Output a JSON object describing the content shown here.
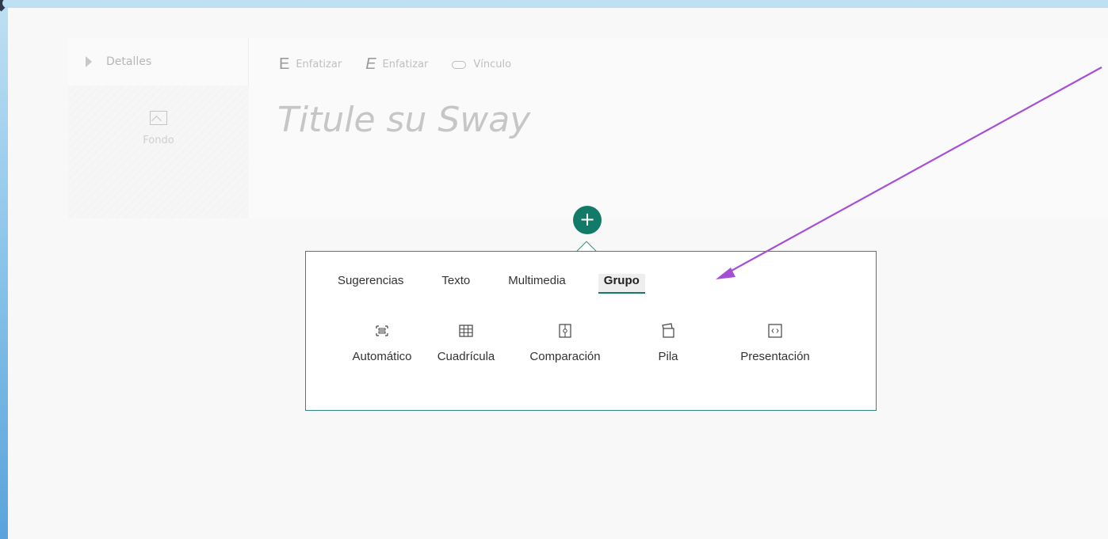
{
  "details": {
    "label": "Detalles"
  },
  "background": {
    "label": "Fondo"
  },
  "toolbar": [
    {
      "glyph": "E",
      "label": "Enfatizar"
    },
    {
      "glyph": "E",
      "label": "Enfatizar"
    },
    {
      "label": "Vínculo"
    }
  ],
  "title_placeholder": "Titule su Sway",
  "insert_button": {
    "icon": "plus-icon",
    "glyph": "+"
  },
  "panel": {
    "tabs": [
      "Sugerencias",
      "Texto",
      "Multimedia",
      "Grupo"
    ],
    "active_tab": "Grupo",
    "options": [
      {
        "label": "Automático",
        "icon": "auto-group-icon"
      },
      {
        "label": "Cuadrícula",
        "icon": "grid-icon"
      },
      {
        "label": "Comparación",
        "icon": "comparison-icon"
      },
      {
        "label": "Pila",
        "icon": "stack-icon"
      },
      {
        "label": "Presentación",
        "icon": "slideshow-icon"
      }
    ]
  },
  "colors": {
    "accent": "#127a68",
    "annotation_arrow": "#a64fd6"
  }
}
